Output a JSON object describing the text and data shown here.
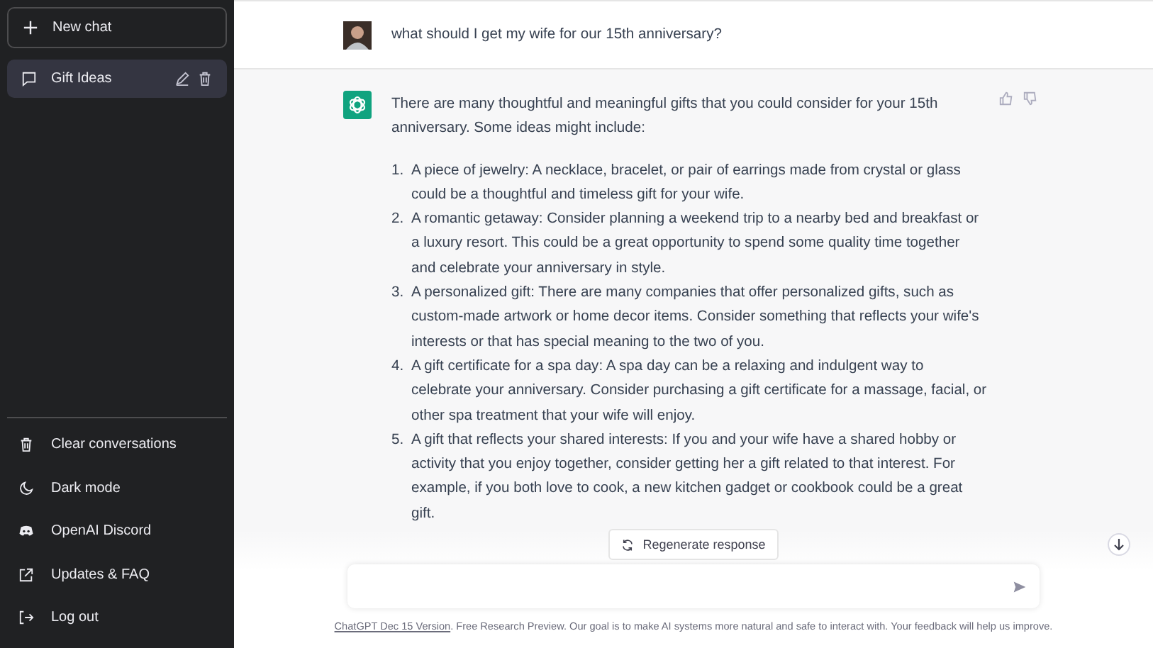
{
  "sidebar": {
    "new_chat": {
      "label": "New chat"
    },
    "conversations": [
      {
        "title": "Gift Ideas",
        "selected": true
      }
    ],
    "menu": [
      {
        "kind": "trash",
        "label": "Clear conversations"
      },
      {
        "kind": "moon",
        "label": "Dark mode"
      },
      {
        "kind": "discord",
        "label": "OpenAI Discord"
      },
      {
        "kind": "external",
        "label": "Updates & FAQ"
      },
      {
        "kind": "logout",
        "label": "Log out"
      }
    ]
  },
  "messages": [
    {
      "kind": "user",
      "text": "what should I get my wife for our 15th anniversary?"
    },
    {
      "kind": "assistant",
      "text": "There are many thoughtful and meaningful gifts that you could consider for your 15th anniversary. Some ideas might include:",
      "list": [
        {
          "number": "1.",
          "text": "A piece of jewelry: A necklace, bracelet, or pair of earrings made from crystal or glass could be a thoughtful and timeless gift for your wife."
        },
        {
          "number": "2.",
          "text": "A romantic getaway: Consider planning a weekend trip to a nearby bed and breakfast or a luxury resort. This could be a great opportunity to spend some quality time together and celebrate your anniversary in style."
        },
        {
          "number": "3.",
          "text": "A personalized gift: There are many companies that offer personalized gifts, such as custom-made artwork or home decor items. Consider something that reflects your wife's interests or that has special meaning to the two of you."
        },
        {
          "number": "4.",
          "text": "A gift certificate for a spa day: A spa day can be a relaxing and indulgent way to celebrate your anniversary. Consider purchasing a gift certificate for a massage, facial, or other spa treatment that your wife will enjoy."
        },
        {
          "number": "5.",
          "text": "A gift that reflects your shared interests: If you and your wife have a shared hobby or activity that you enjoy together, consider getting her a gift related to that interest. For example, if you both love to cook, a new kitchen gadget or cookbook could be a great gift."
        }
      ]
    }
  ],
  "regenerate": {
    "label": "Regenerate response"
  },
  "footer": {
    "link": "ChatGPT Dec 15 Version",
    "text": ". Free Research Preview. Our goal is to make AI systems more natural and safe to interact with. Your feedback will help us improve."
  }
}
